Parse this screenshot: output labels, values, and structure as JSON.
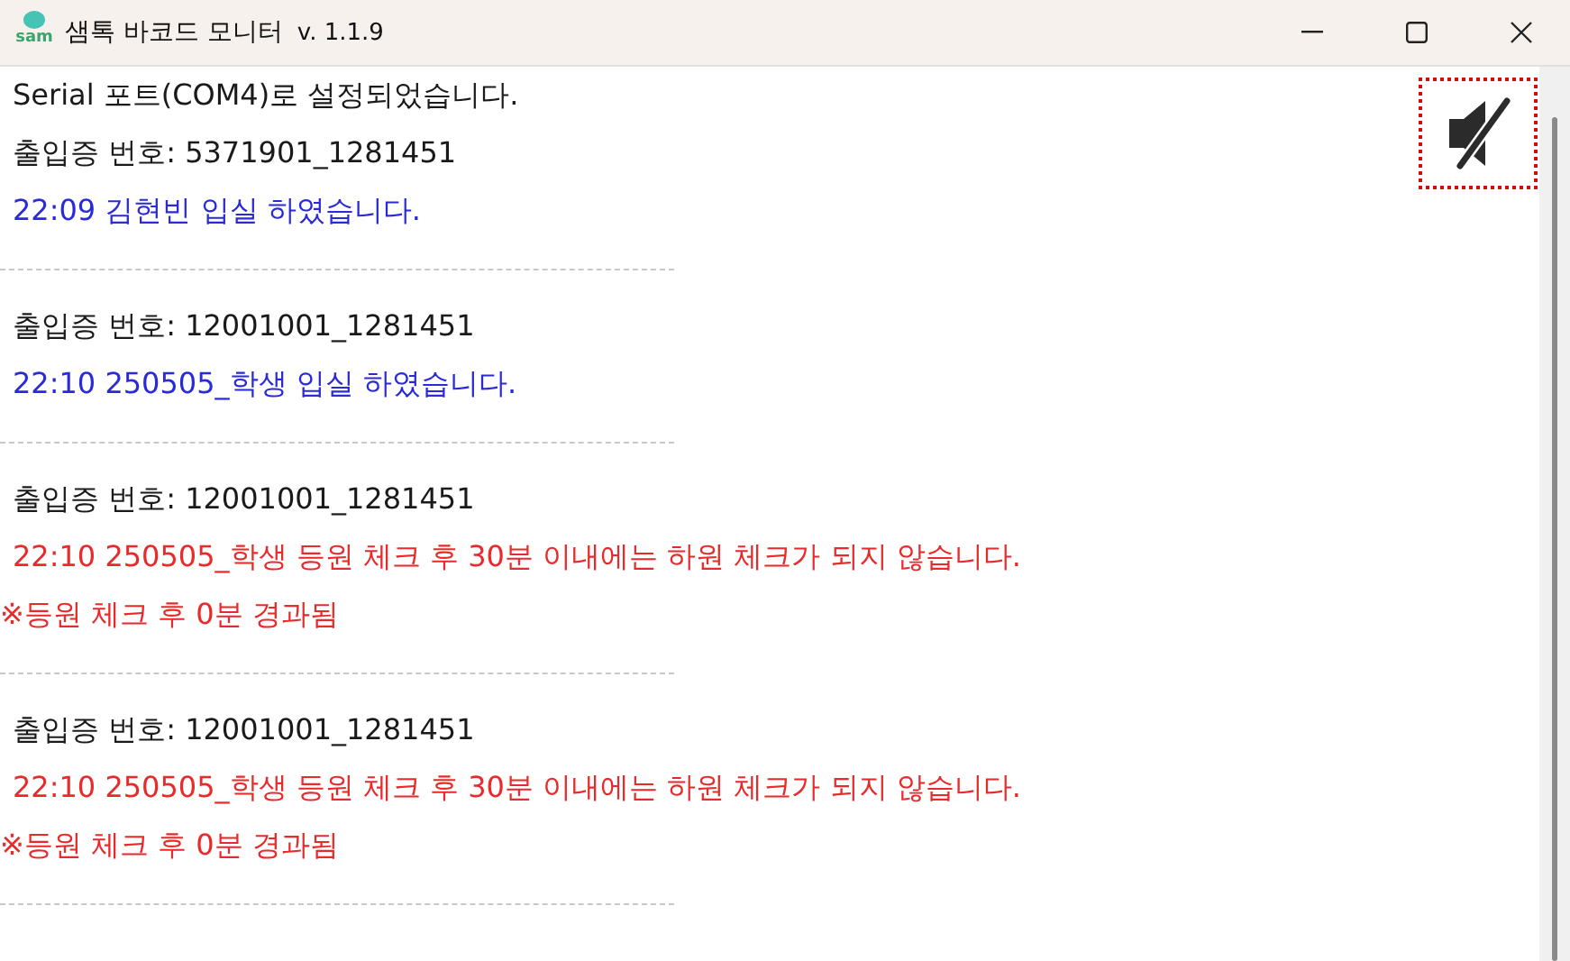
{
  "window": {
    "title": "샘톡 바코드 모니터",
    "version": "v. 1.1.9",
    "logo": "sam"
  },
  "sound": {
    "muted": true
  },
  "log": [
    {
      "lines": [
        {
          "kind": "info",
          "text": "Serial 포트(COM4)로 설정되었습니다."
        },
        {
          "kind": "info",
          "text": "출입증 번호: 5371901_1281451"
        },
        {
          "kind": "success",
          "text": "22:09 김현빈 입실 하였습니다."
        }
      ]
    },
    {
      "lines": [
        {
          "kind": "info",
          "text": "출입증 번호: 12001001_1281451"
        },
        {
          "kind": "success",
          "text": "22:10 250505_학생 입실 하였습니다."
        }
      ]
    },
    {
      "lines": [
        {
          "kind": "info",
          "text": "출입증 번호: 12001001_1281451"
        },
        {
          "kind": "error",
          "text": "22:10 250505_학생 등원 체크 후 30분 이내에는 하원 체크가 되지 않습니다."
        },
        {
          "kind": "note",
          "text": "※등원 체크 후 0분 경과됨"
        }
      ]
    },
    {
      "lines": [
        {
          "kind": "info",
          "text": "출입증 번호: 12001001_1281451"
        },
        {
          "kind": "error",
          "text": "22:10 250505_학생 등원 체크 후 30분 이내에는 하원 체크가 되지 않습니다."
        },
        {
          "kind": "note",
          "text": "※등원 체크 후 0분 경과됨"
        }
      ]
    }
  ]
}
